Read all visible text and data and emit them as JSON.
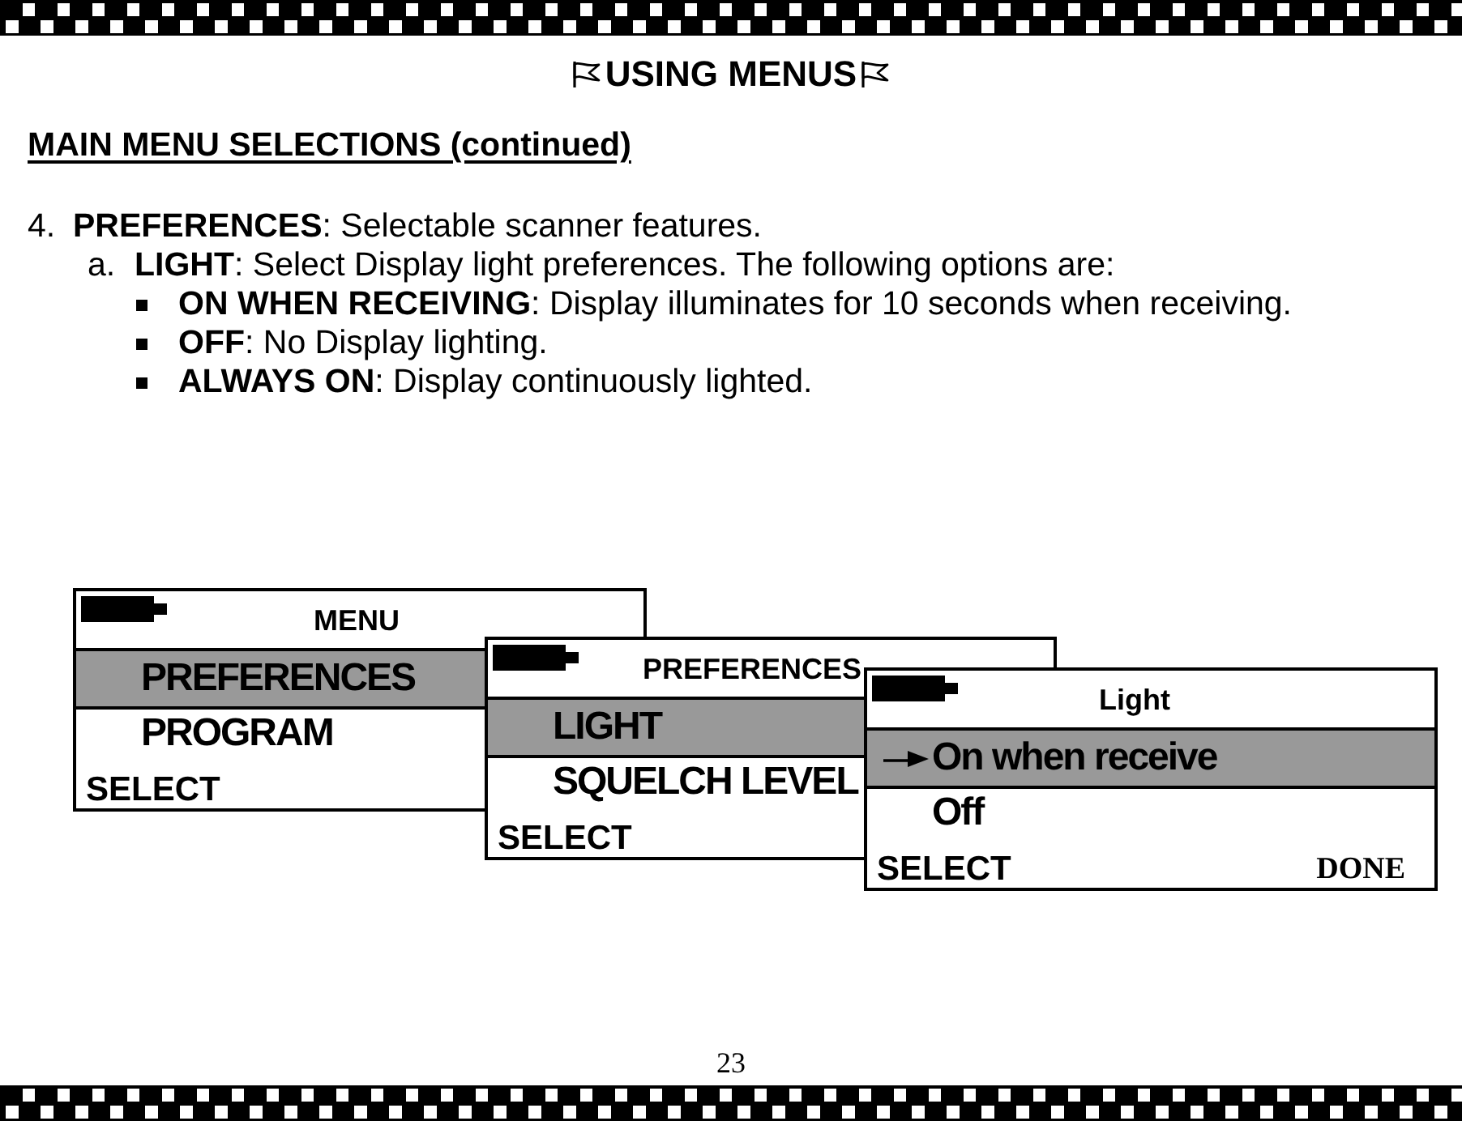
{
  "title": "USING MENUS",
  "section_heading": "MAIN MENU SELECTIONS (continued)",
  "outline": [
    {
      "kind": "label",
      "marker": "4.",
      "text": "**PREFERENCES**: Selectable scanner features.",
      "children": [
        {
          "kind": "label",
          "marker": "a.",
          "text": "**LIGHT**: Select Display light preferences. The following options are:",
          "children": [
            {
              "kind": "bullet",
              "text": "**ON WHEN RECEIVING**: Display illuminates for 10 seconds when receiving."
            },
            {
              "kind": "bullet",
              "text": "**OFF**: No Display lighting."
            },
            {
              "kind": "bullet",
              "text": "**ALWAYS ON**: Display continuously lighted."
            }
          ]
        }
      ]
    }
  ],
  "screens": [
    {
      "title": "MENU",
      "rows": [
        {
          "label": "PREFERENCES",
          "selected": true
        },
        {
          "label": "PROGRAM",
          "selected": false
        }
      ],
      "soft_keys": [
        "SELECT"
      ]
    },
    {
      "title": "PREFERENCES",
      "rows": [
        {
          "label": "LIGHT",
          "selected": true
        },
        {
          "label": "SQUELCH LEVEL",
          "selected": false
        }
      ],
      "soft_keys": [
        "SELECT"
      ]
    },
    {
      "title": "Light",
      "rows": [
        {
          "label": "On when receive",
          "selected": true,
          "current": true
        },
        {
          "label": "Off",
          "selected": false,
          "current": false
        }
      ],
      "soft_keys": [
        "SELECT",
        "DONE"
      ]
    }
  ],
  "page_number": "23"
}
